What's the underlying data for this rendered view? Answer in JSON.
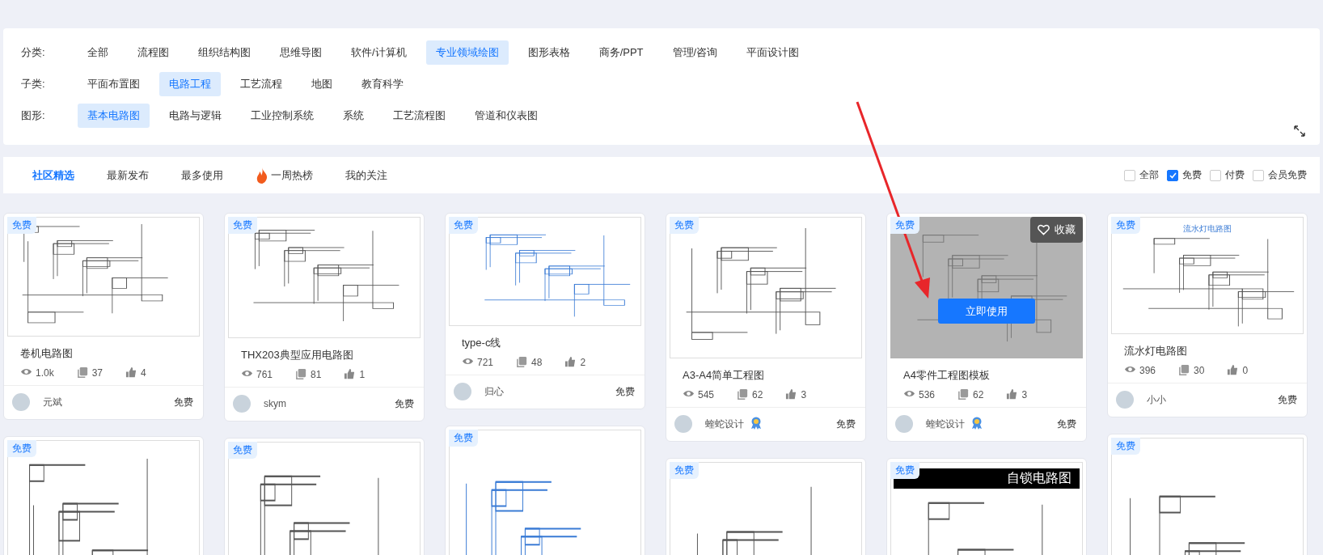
{
  "filters": [
    {
      "label": "分类:",
      "options": [
        {
          "label": "全部",
          "selected": false
        },
        {
          "label": "流程图",
          "selected": false
        },
        {
          "label": "组织结构图",
          "selected": false
        },
        {
          "label": "思维导图",
          "selected": false
        },
        {
          "label": "软件/计算机",
          "selected": false
        },
        {
          "label": "专业领域绘图",
          "selected": true
        },
        {
          "label": "图形表格",
          "selected": false
        },
        {
          "label": "商务/PPT",
          "selected": false
        },
        {
          "label": "管理/咨询",
          "selected": false
        },
        {
          "label": "平面设计图",
          "selected": false
        }
      ]
    },
    {
      "label": "子类:",
      "options": [
        {
          "label": "平面布置图",
          "selected": false
        },
        {
          "label": "电路工程",
          "selected": true
        },
        {
          "label": "工艺流程",
          "selected": false
        },
        {
          "label": "地图",
          "selected": false
        },
        {
          "label": "教育科学",
          "selected": false
        }
      ]
    },
    {
      "label": "图形:",
      "options": [
        {
          "label": "基本电路图",
          "selected": true
        },
        {
          "label": "电路与逻辑",
          "selected": false
        },
        {
          "label": "工业控制系统",
          "selected": false
        },
        {
          "label": "系统",
          "selected": false
        },
        {
          "label": "工艺流程图",
          "selected": false
        },
        {
          "label": "管道和仪表图",
          "selected": false
        }
      ]
    }
  ],
  "sort_tabs": [
    {
      "label": "社区精选",
      "selected": true,
      "hot": false
    },
    {
      "label": "最新发布",
      "selected": false,
      "hot": false
    },
    {
      "label": "最多使用",
      "selected": false,
      "hot": false
    },
    {
      "label": "一周热榜",
      "selected": false,
      "hot": true
    },
    {
      "label": "我的关注",
      "selected": false,
      "hot": false
    }
  ],
  "price_filters": [
    {
      "label": "全部",
      "checked": false
    },
    {
      "label": "免费",
      "checked": true
    },
    {
      "label": "付费",
      "checked": false
    },
    {
      "label": "会员免费",
      "checked": false
    }
  ],
  "columns": [
    [
      {
        "badge": "免费",
        "title": "卷机电路图",
        "views": "1.0k",
        "copies": "37",
        "likes": "4",
        "author": "元斌",
        "verified": false,
        "price": "免费"
      },
      {
        "badge": "免费"
      }
    ],
    [
      {
        "badge": "免费",
        "title": "THX203典型应用电路图",
        "views": "761",
        "copies": "81",
        "likes": "1",
        "author": "skym",
        "verified": false,
        "price": "免费"
      },
      {
        "badge": "免费"
      }
    ],
    [
      {
        "badge": "免费",
        "title": "type-c线",
        "views": "721",
        "copies": "48",
        "likes": "2",
        "author": "归心",
        "verified": false,
        "price": "免费"
      },
      {
        "badge": "免费"
      }
    ],
    [
      {
        "badge": "免费",
        "title": "A3-A4简单工程图",
        "views": "545",
        "copies": "62",
        "likes": "3",
        "author": "蝰蛇设计",
        "verified": true,
        "price": "免费"
      },
      {
        "badge": "免费"
      }
    ],
    [
      {
        "badge": "免费",
        "title": "A4零件工程图模板",
        "views": "536",
        "copies": "62",
        "likes": "3",
        "author": "蝰蛇设计",
        "verified": true,
        "price": "免费",
        "overlay": {
          "favorite": "收藏",
          "use": "立即使用"
        }
      },
      {
        "badge": "免费",
        "thumbnail_title": "自锁电路图"
      }
    ],
    [
      {
        "badge": "免费",
        "thumbnail_title": "流水灯电路图",
        "title": "流水灯电路图",
        "views": "396",
        "copies": "30",
        "likes": "0",
        "author": "小小",
        "verified": false,
        "price": "免费"
      },
      {
        "badge": "免费"
      }
    ]
  ]
}
